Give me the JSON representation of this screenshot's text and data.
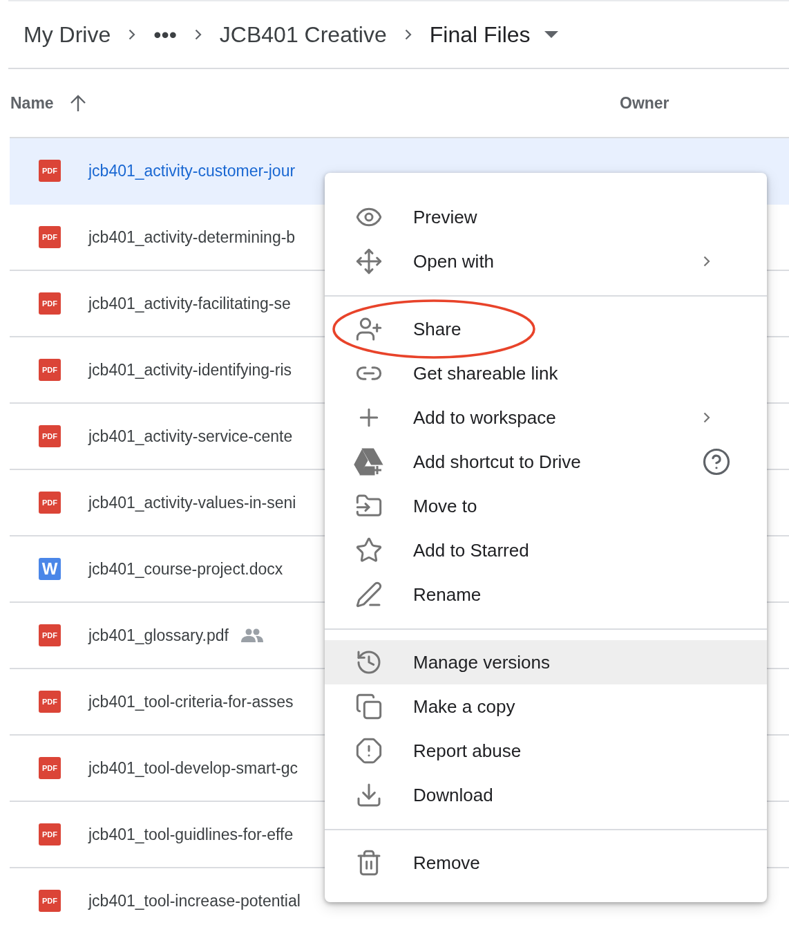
{
  "breadcrumb": {
    "items": [
      {
        "label": "My Drive"
      },
      {
        "label": "•••"
      },
      {
        "label": "JCB401 Creative"
      },
      {
        "label": "Final Files",
        "dropdown": true
      }
    ]
  },
  "table": {
    "columns": [
      {
        "label": "Name"
      },
      {
        "label": "Owner"
      }
    ],
    "rows": [
      {
        "name": "jcb401_activity-customer-jour",
        "color": "#db4437",
        "icon_label": "PDF",
        "shared": false,
        "selected": true
      },
      {
        "name": "jcb401_activity-determining-b",
        "color": "#db4437",
        "icon_label": "PDF",
        "shared": false,
        "selected": false
      },
      {
        "name": "jcb401_activity-facilitating-se",
        "color": "#db4437",
        "icon_label": "PDF",
        "shared": false,
        "selected": false
      },
      {
        "name": "jcb401_activity-identifying-ris",
        "color": "#db4437",
        "icon_label": "PDF",
        "shared": false,
        "selected": false
      },
      {
        "name": "jcb401_activity-service-cente",
        "color": "#db4437",
        "icon_label": "PDF",
        "shared": false,
        "selected": false
      },
      {
        "name": "jcb401_activity-values-in-seni",
        "color": "#db4437",
        "icon_label": "PDF",
        "shared": false,
        "selected": false
      },
      {
        "name": "jcb401_course-project.docx",
        "color": "#4a86e8",
        "icon_label": "W",
        "shared": false,
        "selected": false
      },
      {
        "name": "jcb401_glossary.pdf",
        "color": "#db4437",
        "icon_label": "PDF",
        "shared": true,
        "selected": false
      },
      {
        "name": "jcb401_tool-criteria-for-asses",
        "color": "#db4437",
        "icon_label": "PDF",
        "shared": false,
        "selected": false
      },
      {
        "name": "jcb401_tool-develop-smart-gc",
        "color": "#db4437",
        "icon_label": "PDF",
        "shared": false,
        "selected": false
      },
      {
        "name": "jcb401_tool-guidlines-for-effe",
        "color": "#db4437",
        "icon_label": "PDF",
        "shared": false,
        "selected": false
      },
      {
        "name": "jcb401_tool-increase-potential",
        "color": "#db4437",
        "icon_label": "PDF",
        "shared": false,
        "selected": false
      }
    ]
  },
  "context_menu": {
    "sections": [
      {
        "items": [
          {
            "label": "Preview",
            "submenu": false,
            "help": false,
            "hovered": false,
            "circled": false
          },
          {
            "label": "Open with",
            "submenu": true,
            "help": false,
            "hovered": false,
            "circled": false
          }
        ]
      },
      {
        "items": [
          {
            "label": "Share",
            "submenu": false,
            "help": false,
            "hovered": false,
            "circled": true
          },
          {
            "label": "Get shareable link",
            "submenu": false,
            "help": false,
            "hovered": false,
            "circled": false
          },
          {
            "label": "Add to workspace",
            "submenu": true,
            "help": false,
            "hovered": false,
            "circled": false
          },
          {
            "label": "Add shortcut to Drive",
            "submenu": false,
            "help": true,
            "hovered": false,
            "circled": false
          },
          {
            "label": "Move to",
            "submenu": false,
            "help": false,
            "hovered": false,
            "circled": false
          },
          {
            "label": "Add to Starred",
            "submenu": false,
            "help": false,
            "hovered": false,
            "circled": false
          },
          {
            "label": "Rename",
            "submenu": false,
            "help": false,
            "hovered": false,
            "circled": false
          }
        ]
      },
      {
        "items": [
          {
            "label": "Manage versions",
            "submenu": false,
            "help": false,
            "hovered": true,
            "circled": false
          },
          {
            "label": "Make a copy",
            "submenu": false,
            "help": false,
            "hovered": false,
            "circled": false
          },
          {
            "label": "Report abuse",
            "submenu": false,
            "help": false,
            "hovered": false,
            "circled": false
          },
          {
            "label": "Download",
            "submenu": false,
            "help": false,
            "hovered": false,
            "circled": false
          }
        ]
      },
      {
        "items": [
          {
            "label": "Remove",
            "submenu": false,
            "help": false,
            "hovered": false,
            "circled": false
          }
        ]
      }
    ]
  }
}
